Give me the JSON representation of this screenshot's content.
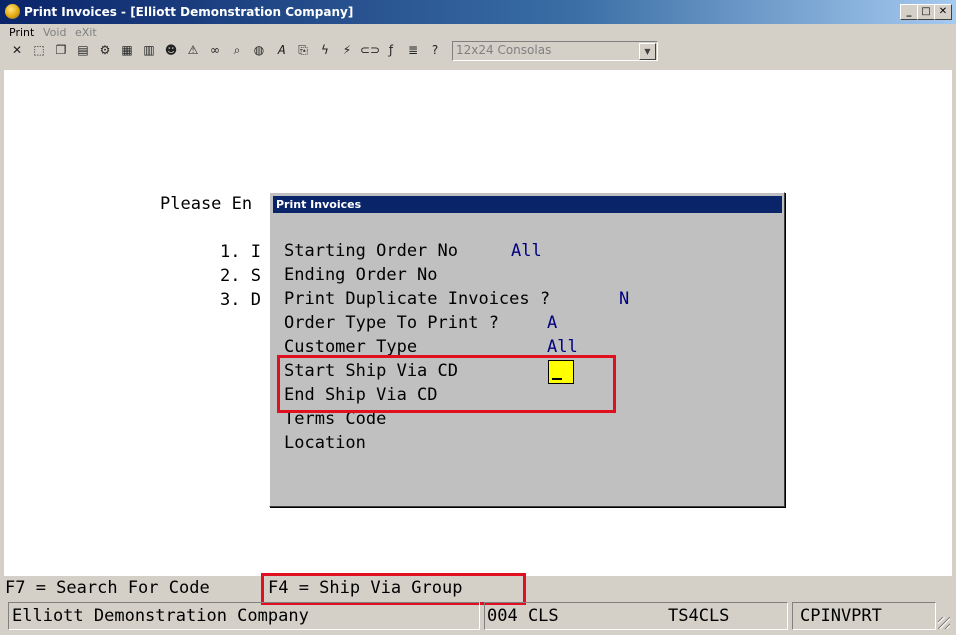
{
  "window": {
    "title": "Print Invoices - [Elliott Demonstration Company]",
    "controls": {
      "minimize": "_",
      "maximize": "□",
      "close": "✕"
    }
  },
  "menu": [
    {
      "label": "Print",
      "enabled": true
    },
    {
      "label": "Void",
      "enabled": false
    },
    {
      "label": "eXit",
      "enabled": false
    }
  ],
  "toolbar": {
    "font_value": "12x24 Consolas",
    "icons": [
      "close-icon",
      "select-icon",
      "copy-icon",
      "paste-icon",
      "settings-icon",
      "properties-icon",
      "notes-icon",
      "user-icon",
      "alert-icon",
      "binoculars-icon",
      "zoom-icon",
      "globe-icon",
      "font-icon",
      "attach-icon",
      "lightning-icon",
      "macro-icon",
      "link-icon",
      "function-icon",
      "list-icon",
      "help-icon"
    ]
  },
  "background": {
    "prompt": "Please En",
    "items": [
      "1. I",
      "2. S",
      "3. D"
    ]
  },
  "dialog": {
    "title": "Print Invoices",
    "fields": [
      {
        "label": "Starting Order No",
        "value": "All"
      },
      {
        "label": "Ending Order No",
        "value": ""
      },
      {
        "label": "Print Duplicate Invoices ?",
        "value": "N"
      },
      {
        "label": "Order Type To Print ?",
        "value": "A"
      },
      {
        "label": "Customer Type",
        "value": "All"
      },
      {
        "label": "Start Ship Via CD",
        "value": ""
      },
      {
        "label": "End Ship Via CD",
        "value": ""
      },
      {
        "label": "Terms Code",
        "value": ""
      },
      {
        "label": "Location",
        "value": ""
      }
    ]
  },
  "function_keys": {
    "f7": "F7 = Search For Code",
    "f4": "F4 = Ship Via Group"
  },
  "status_bar": {
    "company": "Elliott Demonstration Company",
    "code": "004 CLS",
    "terminal": "TS4CLS",
    "program": "CPINVPRT"
  },
  "colors": {
    "title_bar": "#0a246a",
    "value_text": "#000080",
    "active_input": "#ffff00",
    "highlight_box": "#e01020"
  }
}
